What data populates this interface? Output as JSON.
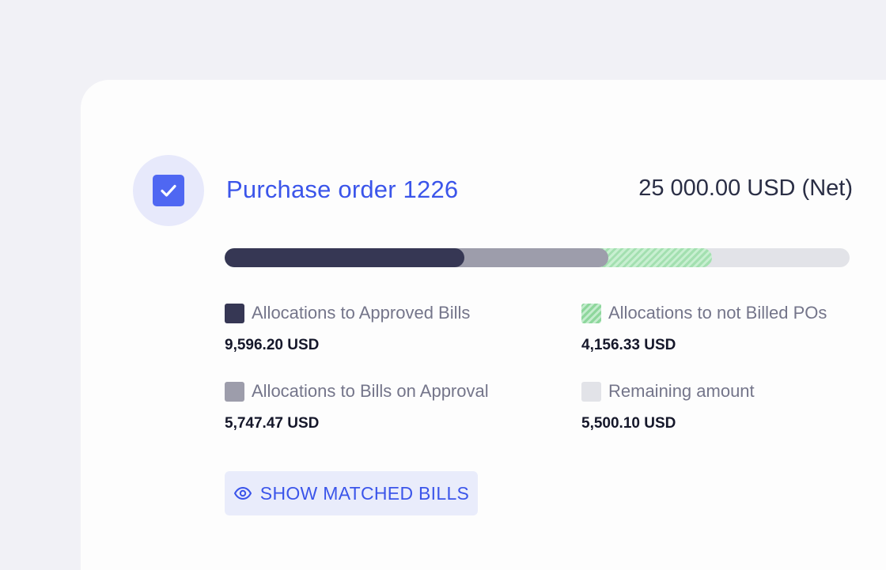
{
  "purchase_order": {
    "title": "Purchase order 1226",
    "net_amount": "25 000.00 USD (Net)",
    "checked": true
  },
  "allocation_bar": {
    "total": 25000.0,
    "segments": [
      {
        "key": "approved",
        "value": 9596.2,
        "color": "#363754"
      },
      {
        "key": "approval",
        "value": 5747.47,
        "color": "#9d9dab"
      },
      {
        "key": "notbilled",
        "value": 4156.33,
        "color": "#a3e0b0"
      }
    ],
    "track_color": "#e2e3e8"
  },
  "legend": [
    {
      "label": "Allocations to Approved Bills",
      "value": "9,596.20 USD",
      "color": "#363754"
    },
    {
      "label": "Allocations to not Billed POs",
      "value": "4,156.33 USD",
      "color": "#8ed79c"
    },
    {
      "label": "Allocations to Bills on Approval",
      "value": "5,747.47 USD",
      "color": "#9d9dab"
    },
    {
      "label": "Remaining amount",
      "value": "5,500.10 USD",
      "color": "#e2e3e8"
    }
  ],
  "actions": {
    "show_matched_bills": "SHOW MATCHED BILLS",
    "show_matched_bills_icon": "eye-icon"
  },
  "colors": {
    "accent": "#3b55ea",
    "checkbox": "#4f67f2",
    "badge_bg": "#e7e9fb"
  }
}
